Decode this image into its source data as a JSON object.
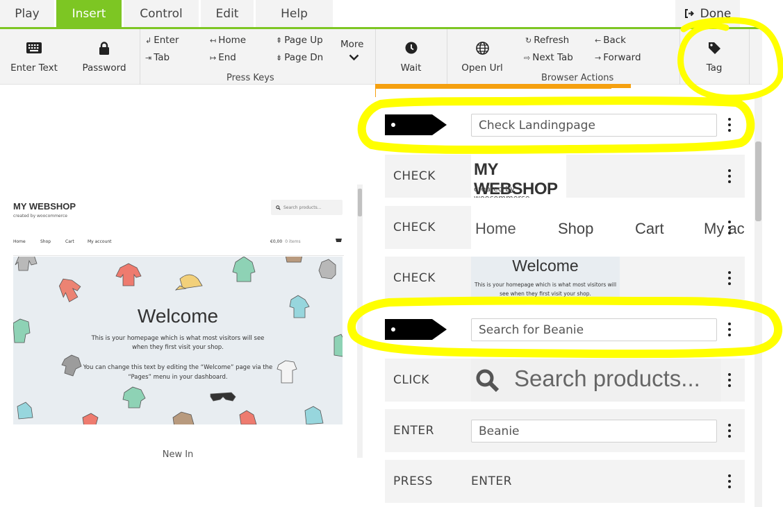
{
  "tabs": [
    {
      "label": "Play",
      "active": false
    },
    {
      "label": "Insert",
      "active": true
    },
    {
      "label": "Control",
      "active": false
    },
    {
      "label": "Edit",
      "active": false
    },
    {
      "label": "Help",
      "active": false
    }
  ],
  "done_label": "Done",
  "ribbon": {
    "enter_text": "Enter Text",
    "password": "Password",
    "press_keys": {
      "group_label": "Press Keys",
      "enter": "Enter",
      "tab": "Tab",
      "home": "Home",
      "end": "End",
      "page_up": "Page Up",
      "page_dn": "Page Dn",
      "more": "More"
    },
    "wait": "Wait",
    "browser": {
      "group_label": "Browser Actions",
      "open_url": "Open Url",
      "refresh": "Refresh",
      "next_tab": "Next Tab",
      "back": "Back",
      "forward": "Forward"
    },
    "tag": "Tag"
  },
  "preview": {
    "site_title": "MY WEBSHOP",
    "site_subtitle": "created by woocommerce",
    "search_placeholder": "Search products...",
    "nav": [
      "Home",
      "Shop",
      "Cart",
      "My account"
    ],
    "cart_total": "€0,00",
    "cart_items": "0 items",
    "welcome": "Welcome",
    "intro": "This is your homepage which is what most visitors will see when they first visit your shop.",
    "edit_note": "You can change this text by editing the “Welcome” page via the “Pages” menu in your dashboard.",
    "new_in": "New In"
  },
  "steps": [
    {
      "type": "tag",
      "value": "Check Landingpage"
    },
    {
      "action": "CHECK",
      "crop": "title",
      "title": "MY WEBSHOP",
      "subtitle": "created by woocommerce"
    },
    {
      "action": "CHECK",
      "crop": "menu",
      "items": [
        "Home",
        "Shop",
        "Cart",
        "My ac"
      ]
    },
    {
      "action": "CHECK",
      "crop": "welcome",
      "title": "Welcome",
      "text": "This is your homepage which is what most visitors will see when they first visit your shop."
    },
    {
      "type": "tag",
      "value": "Search for Beanie"
    },
    {
      "action": "CLICK",
      "crop": "search",
      "text": "Search products..."
    },
    {
      "action": "ENTER",
      "value": "Beanie"
    },
    {
      "action": "PRESS",
      "value": "ENTER"
    }
  ],
  "colors": {
    "accent": "#7dc623",
    "highlight": "#ffff00",
    "orange": "#f5a00f",
    "tag": "#000000",
    "row_bg": "#f3f3f3"
  }
}
